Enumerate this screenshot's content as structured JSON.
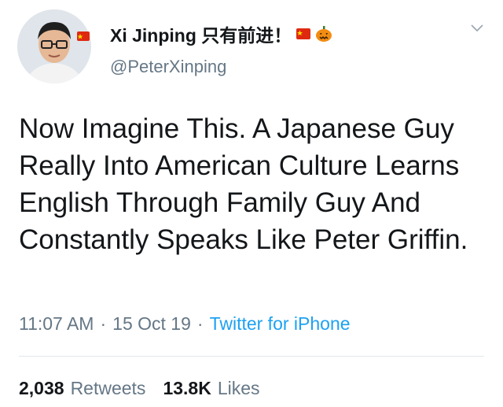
{
  "user": {
    "display_name": "Xi Jinping 只有前进！",
    "handle": "@PeterXinping",
    "avatar_icon": "profile-photo",
    "flag_badge_color": "#de2910",
    "name_emoji": [
      "flag-china-icon",
      "pumpkin-icon"
    ]
  },
  "tweet": {
    "text": "Now Imagine This. A Japanese Guy Really Into American Culture Learns English Through Family Guy And Constantly Speaks Like Peter Griffin."
  },
  "meta": {
    "time": "11:07 AM",
    "separator": "·",
    "date": "15 Oct 19",
    "source": "Twitter for iPhone"
  },
  "stats": {
    "retweets_count": "2,038",
    "retweets_label": "Retweets",
    "likes_count": "13.8K",
    "likes_label": "Likes"
  },
  "colors": {
    "text": "#14171a",
    "secondary": "#657786",
    "link": "#1da1f2"
  }
}
